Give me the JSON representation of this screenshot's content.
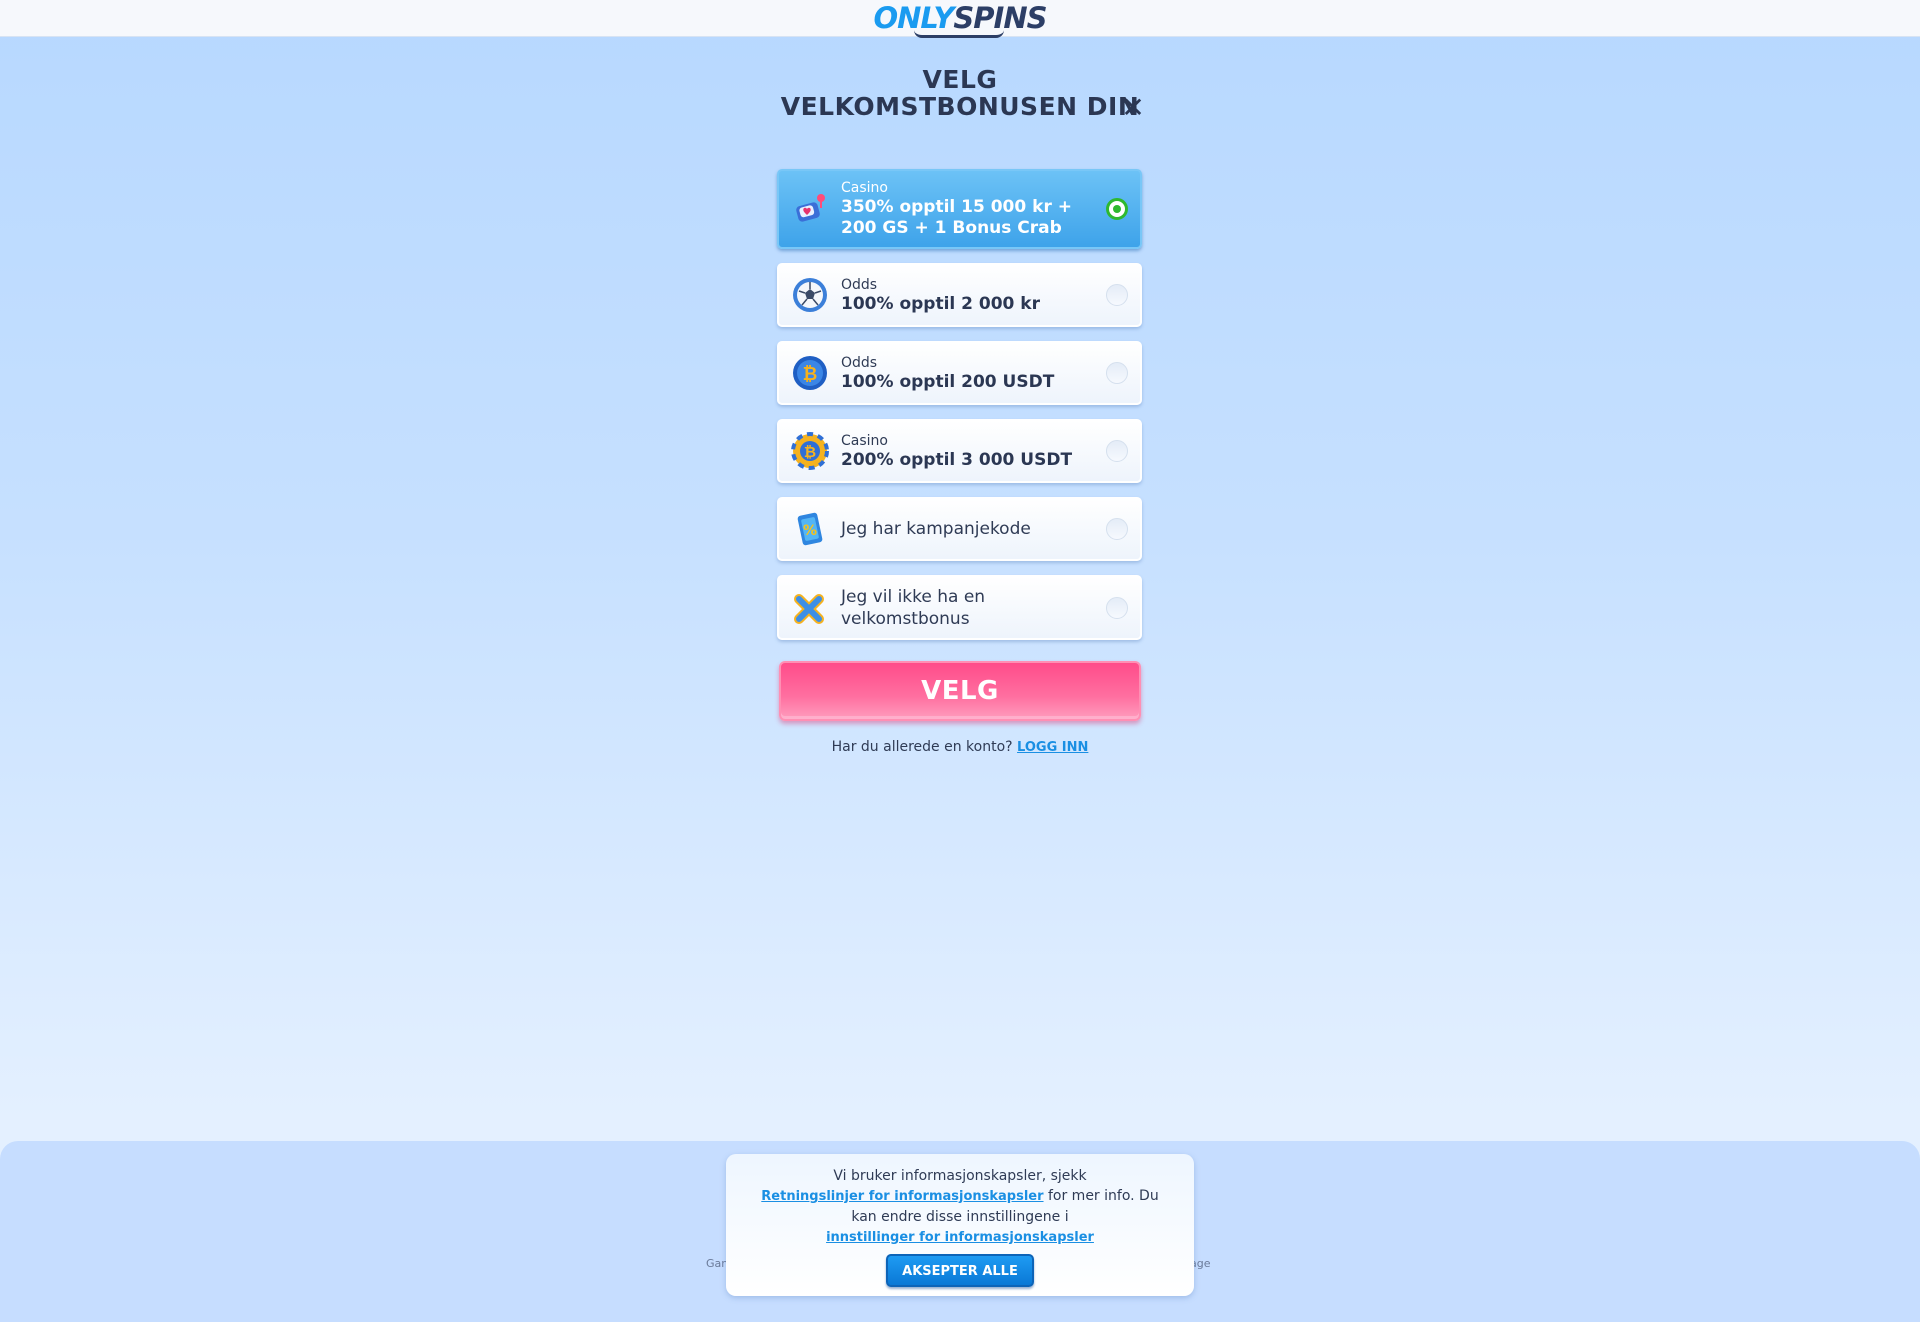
{
  "header": {
    "logo_only": "ONLY",
    "logo_spins": "SPINS"
  },
  "modal": {
    "title": "VELG VELKOMSTBONUSEN DIN",
    "close_symbol": "✕",
    "options": [
      {
        "category": "Casino",
        "offer": "350% opptil 15 000 kr + 200 GS + 1 Bonus Crab",
        "icon": "casino-hearts-icon",
        "selected": true
      },
      {
        "category": "Odds",
        "offer": "100% opptil 2 000 kr",
        "icon": "football-icon",
        "selected": false
      },
      {
        "category": "Odds",
        "offer": "100% opptil 200 USDT",
        "icon": "bitcoin-ball-icon",
        "selected": false
      },
      {
        "category": "Casino",
        "offer": "200% opptil 3 000 USDT",
        "icon": "bitcoin-chip-icon",
        "selected": false
      },
      {
        "label": "Jeg har kampanjekode",
        "icon": "promo-ticket-icon",
        "selected": false
      },
      {
        "label": "Jeg vil ikke ha en velkomstbonus",
        "icon": "cross-icon",
        "selected": false
      }
    ],
    "submit_label": "VELG",
    "login_prompt": "Har du allerede en konto?",
    "login_link": "LOGG INN"
  },
  "footer": {
    "left_fragment": "Gam",
    "right_fragment": "age"
  },
  "cookie_banner": {
    "text_1": "Vi bruker informasjonskapsler, sjekk",
    "link_1": "Retningslinjer for informasjonskapsler",
    "text_2": "for mer info. Du kan endre disse innstillingene i",
    "link_2": "innstillinger for informasjonskapsler",
    "accept_label": "AKSEPTER ALLE"
  },
  "colors": {
    "accent_blue": "#1a9bf0",
    "selected_green": "#2eb82e",
    "cta_pink": "#ff4c8a",
    "text_dark": "#2b3753"
  }
}
